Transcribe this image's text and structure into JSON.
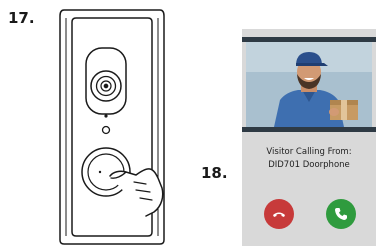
{
  "figures": {
    "doorbell_label": "17.",
    "monitor_label": "18."
  },
  "monitor": {
    "caller_title": "Visitor Calling From:",
    "caller_name": "DID701 Doorphone",
    "decline_icon": "hang-up-icon",
    "answer_icon": "phone-icon"
  },
  "colors": {
    "decline": "#c73a3a",
    "answer": "#2f9b3e",
    "screen_bg": "#d9d9d9"
  }
}
